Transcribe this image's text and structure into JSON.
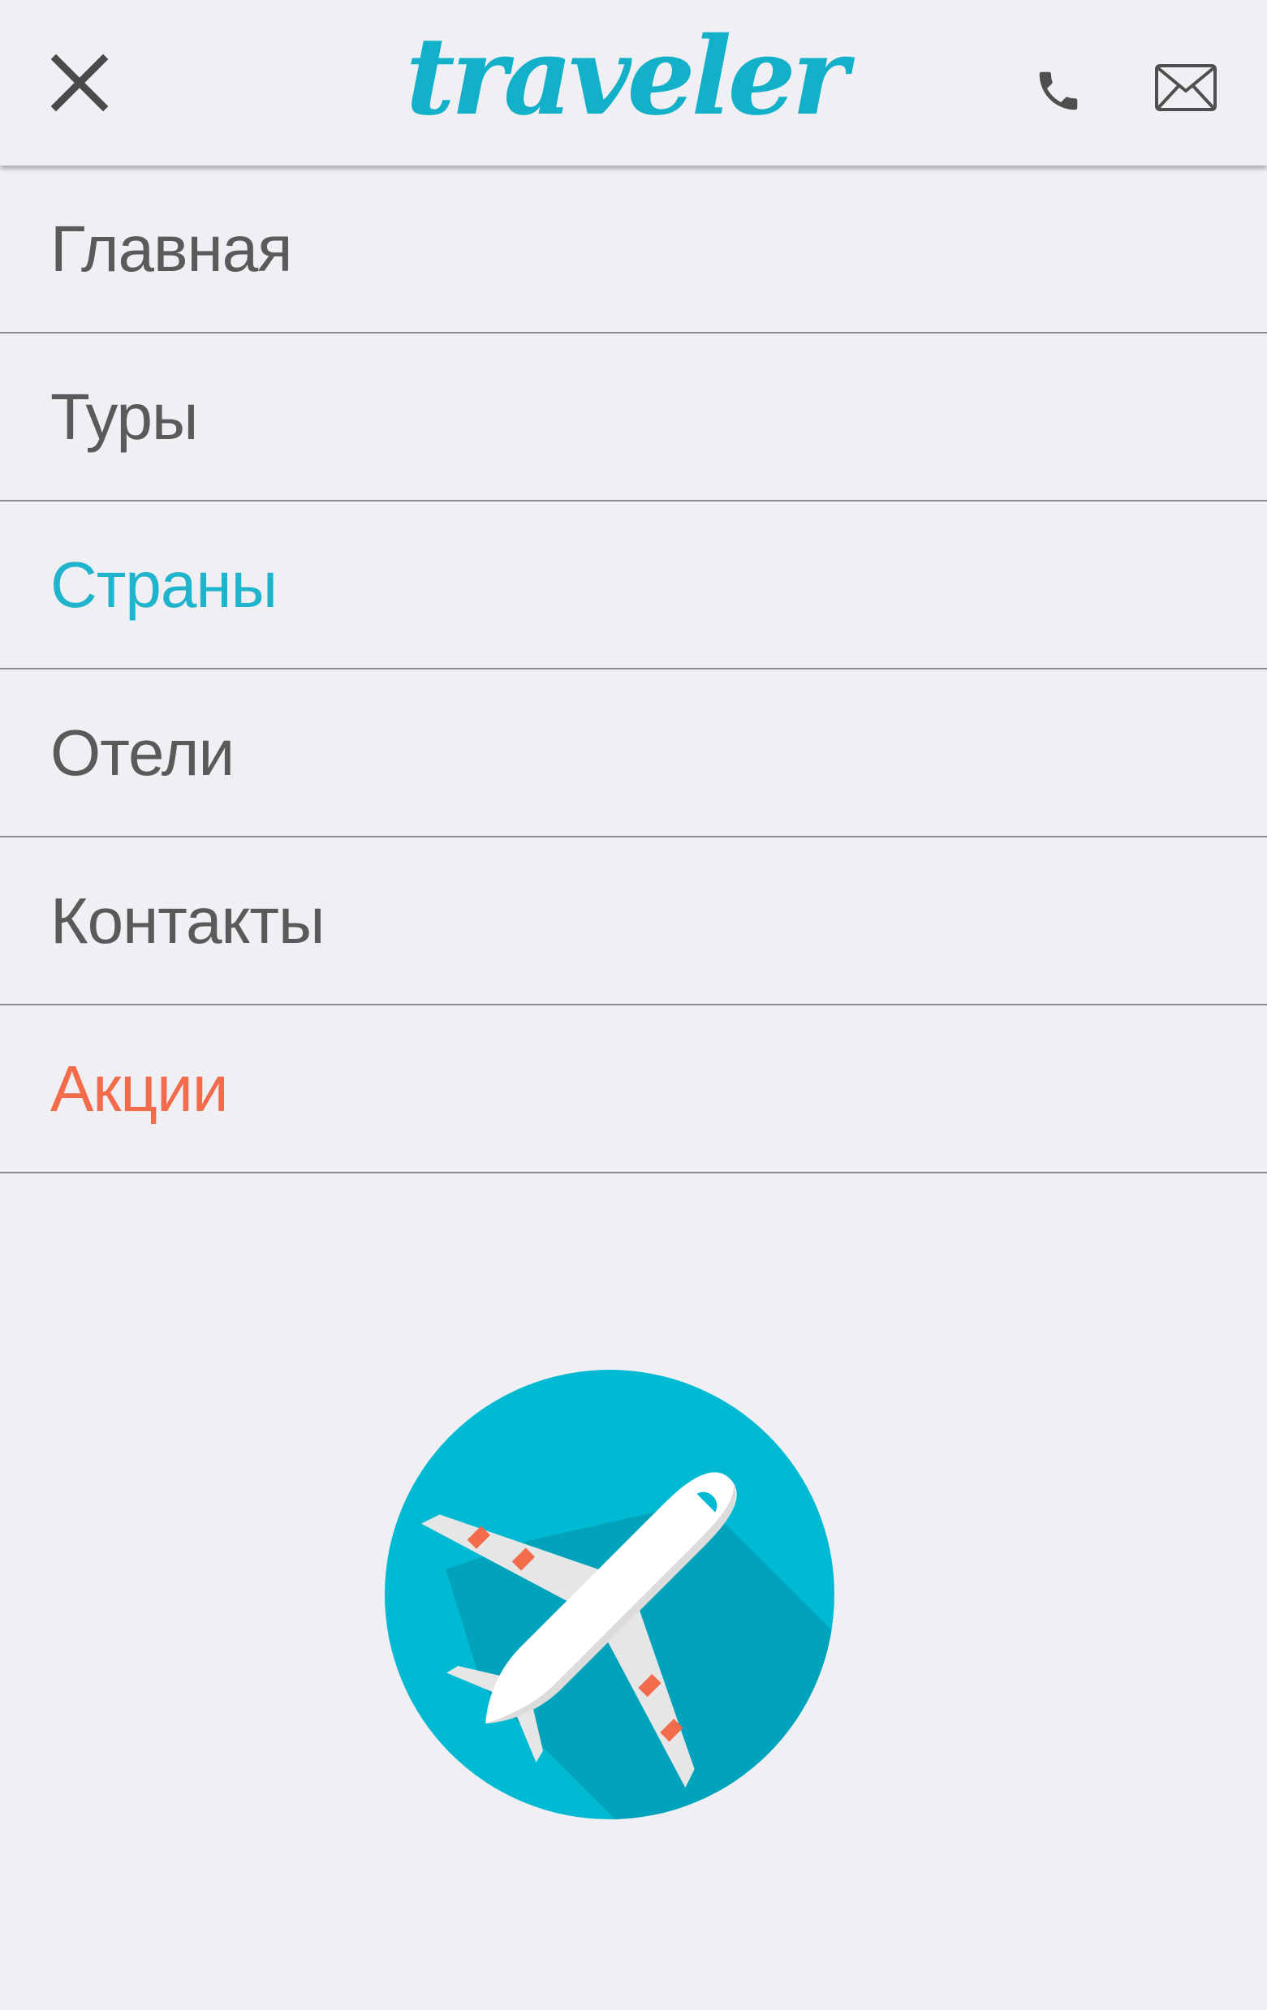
{
  "header": {
    "logo_text": "traveler",
    "close_icon": "close-icon",
    "phone_icon": "phone-icon",
    "mail_icon": "mail-icon"
  },
  "menu": {
    "items": [
      {
        "label": "Главная",
        "state": "default"
      },
      {
        "label": "Туры",
        "state": "default"
      },
      {
        "label": "Страны",
        "state": "active"
      },
      {
        "label": "Отели",
        "state": "default"
      },
      {
        "label": "Контакты",
        "state": "default"
      },
      {
        "label": "Акции",
        "state": "promo"
      }
    ]
  },
  "badge": {
    "icon": "airplane-icon"
  },
  "colors": {
    "accent": "#1fb4cc",
    "promo": "#f26b4a",
    "text": "#5a5a5a",
    "background": "#efeff4",
    "badge_circle": "#00bad3",
    "badge_shadow": "#00a3bb",
    "engine": "#f26b4a"
  }
}
